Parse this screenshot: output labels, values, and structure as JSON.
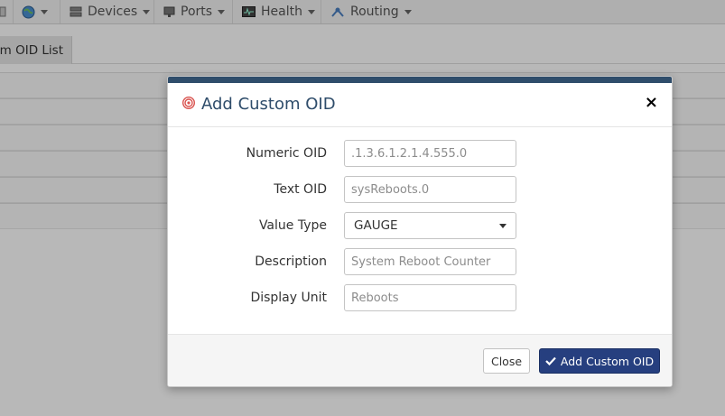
{
  "navbar": {
    "items": [
      {
        "label": "",
        "icon": "globe-icon"
      },
      {
        "label": "Devices",
        "icon": "server-icon"
      },
      {
        "label": "Ports",
        "icon": "network-port-icon"
      },
      {
        "label": "Health",
        "icon": "health-monitor-icon"
      },
      {
        "label": "Routing",
        "icon": "routing-icon"
      }
    ]
  },
  "tabs": {
    "active": "om OID List"
  },
  "modal": {
    "title": "Add Custom OID",
    "title_icon": "target-icon",
    "close_glyph": "×",
    "fields": {
      "numeric_oid": {
        "label": "Numeric OID",
        "value": "",
        "placeholder": ".1.3.6.1.2.1.4.555.0"
      },
      "text_oid": {
        "label": "Text OID",
        "value": "",
        "placeholder": "sysReboots.0"
      },
      "value_type": {
        "label": "Value Type",
        "selected": "GAUGE"
      },
      "description": {
        "label": "Description",
        "value": "",
        "placeholder": "System Reboot Counter"
      },
      "display_unit": {
        "label": "Display Unit",
        "value": "",
        "placeholder": "Reboots"
      }
    },
    "footer": {
      "close_label": "Close",
      "submit_label": "Add Custom OID",
      "submit_icon": "checkmark-icon"
    }
  },
  "colors": {
    "accent": "#2f4d6b",
    "primary_button": "#263f7f"
  }
}
